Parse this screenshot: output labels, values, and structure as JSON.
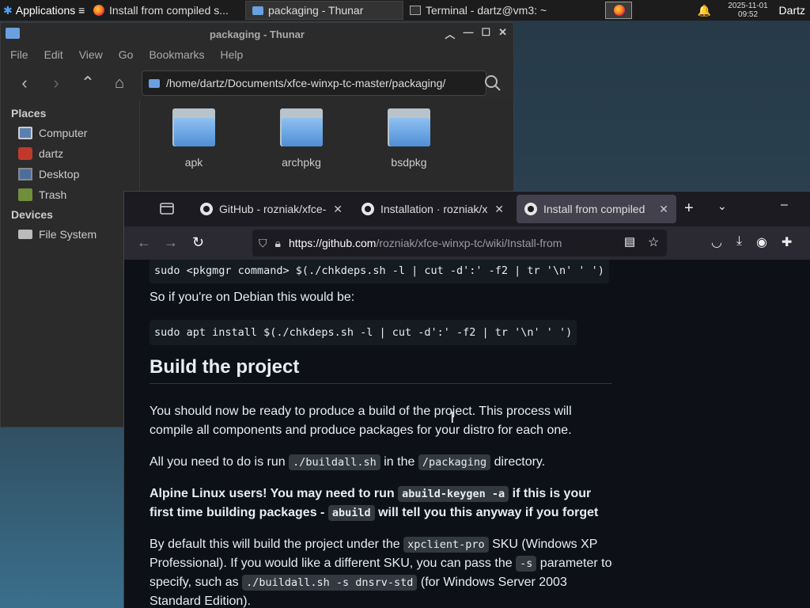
{
  "panel": {
    "applications": "Applications ≡",
    "tasks": [
      {
        "label": "Install from compiled s..."
      },
      {
        "label": "packaging - Thunar"
      },
      {
        "label": "Terminal - dartz@vm3: ~"
      }
    ],
    "clock_date": "2025-11-01",
    "clock_time": "09:52",
    "user": "Dartz"
  },
  "thunar": {
    "title": "packaging - Thunar",
    "menu": [
      "File",
      "Edit",
      "View",
      "Go",
      "Bookmarks",
      "Help"
    ],
    "path": "/home/dartz/Documents/xfce-winxp-tc-master/packaging/",
    "places_heading": "Places",
    "places": [
      "Computer",
      "dartz",
      "Desktop",
      "Trash"
    ],
    "devices_heading": "Devices",
    "devices": [
      "File System"
    ],
    "folders": [
      "apk",
      "archpkg",
      "bsdpkg"
    ]
  },
  "firefox": {
    "tabs": [
      {
        "label": "GitHub - rozniak/xfce-"
      },
      {
        "label": "Installation · rozniak/x"
      },
      {
        "label": "Install from compiled"
      }
    ],
    "url_domain": "https://github.com",
    "url_path": "/rozniak/xfce-winxp-tc/wiki/Install-from",
    "content": {
      "code1": "sudo <pkgmgr command> $(./chkdeps.sh -l | cut -d':' -f2 | tr '\\n' ' ')",
      "debian_note": "So if you're on Debian this would be:",
      "code2": "sudo apt install $(./chkdeps.sh -l | cut -d':' -f2 | tr '\\n' ' ')",
      "heading": "Build the project",
      "p1": "You should now be ready to produce a build of the project. This process will compile all components and produce packages for your distro for each one.",
      "p2_a": "All you need to do is run",
      "p2_code1": "./buildall.sh",
      "p2_b": "in the",
      "p2_code2": "/packaging",
      "p2_c": "directory.",
      "p3_a": "Alpine Linux users! You may need to run",
      "p3_code1": "abuild-keygen -a",
      "p3_b": "if this is your first time building packages -",
      "p3_code2": "abuild",
      "p3_c": "will tell you this anyway if you forget",
      "p4_a": "By default this will build the project under the",
      "p4_code1": "xpclient-pro",
      "p4_b": "SKU (Windows XP Professional). If you would like a different SKU, you can pass the",
      "p4_code2": "-s",
      "p4_c": "parameter to specify, such as",
      "p4_code3": "./buildall.sh -s dnsrv-std",
      "p4_d": "(for Windows Server 2003 Standard Edition)."
    }
  }
}
